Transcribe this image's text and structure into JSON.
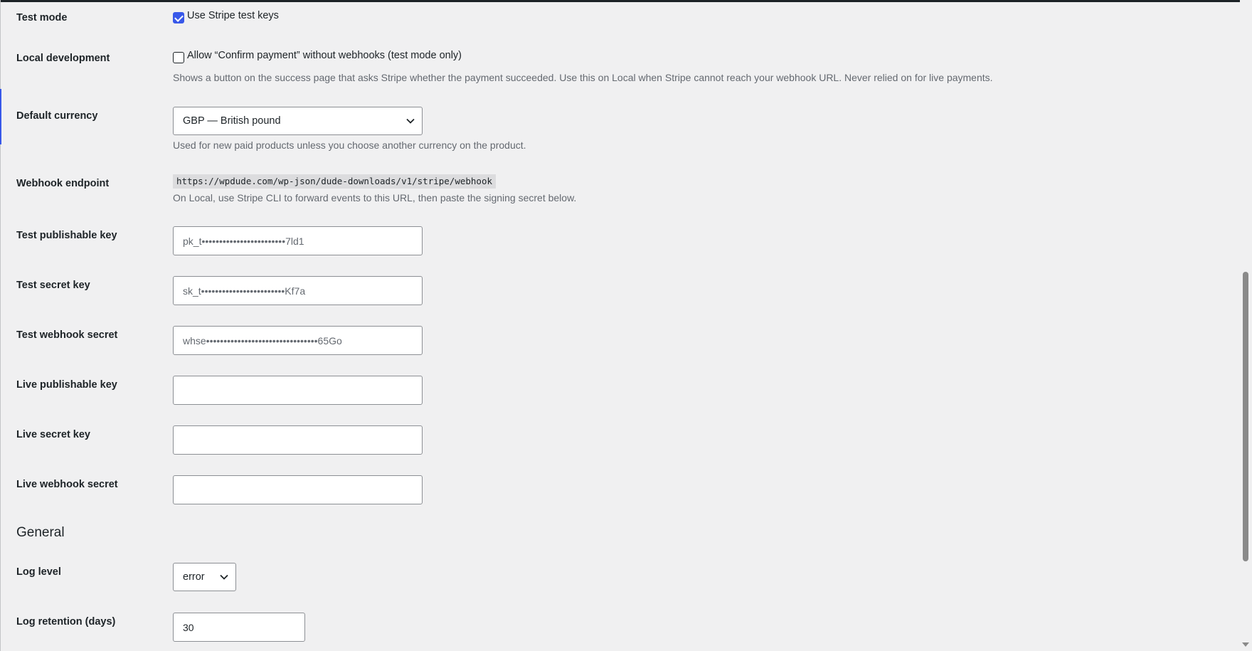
{
  "rows": {
    "test_mode": {
      "label": "Test mode",
      "checkbox_label": "Use Stripe test keys",
      "checked": true
    },
    "local_dev": {
      "label": "Local development",
      "checkbox_label": "Allow “Confirm payment” without webhooks (test mode only)",
      "checked": false,
      "description": "Shows a button on the success page that asks Stripe whether the payment succeeded. Use this on Local when Stripe cannot reach your webhook URL. Never relied on for live payments."
    },
    "currency": {
      "label": "Default currency",
      "selected": "GBP — British pound",
      "description": "Used for new paid products unless you choose another currency on the product."
    },
    "webhook": {
      "label": "Webhook endpoint",
      "url": "https://wpdude.com/wp-json/dude-downloads/v1/stripe/webhook",
      "description": "On Local, use Stripe CLI to forward events to this URL, then paste the signing secret below."
    },
    "test_pub_key": {
      "label": "Test publishable key",
      "value": "pk_t••••••••••••••••••••••••7ld1"
    },
    "test_secret_key": {
      "label": "Test secret key",
      "value": "sk_t••••••••••••••••••••••••Kf7a"
    },
    "test_webhook_secret": {
      "label": "Test webhook secret",
      "value": "whse••••••••••••••••••••••••••••••••65Go"
    },
    "live_pub_key": {
      "label": "Live publishable key",
      "value": ""
    },
    "live_secret_key": {
      "label": "Live secret key",
      "value": ""
    },
    "live_webhook_secret": {
      "label": "Live webhook secret",
      "value": ""
    }
  },
  "general": {
    "heading": "General",
    "log_level": {
      "label": "Log level",
      "selected": "error"
    },
    "log_retention": {
      "label": "Log retention (days)",
      "value": "30"
    }
  },
  "icons": {
    "select_arrow": "chevron-down-icon",
    "checkbox_check": "checkmark-icon"
  },
  "colors": {
    "accent": "#3858e9",
    "background": "#f0f0f1",
    "text": "#1d2327",
    "muted": "#646970"
  }
}
